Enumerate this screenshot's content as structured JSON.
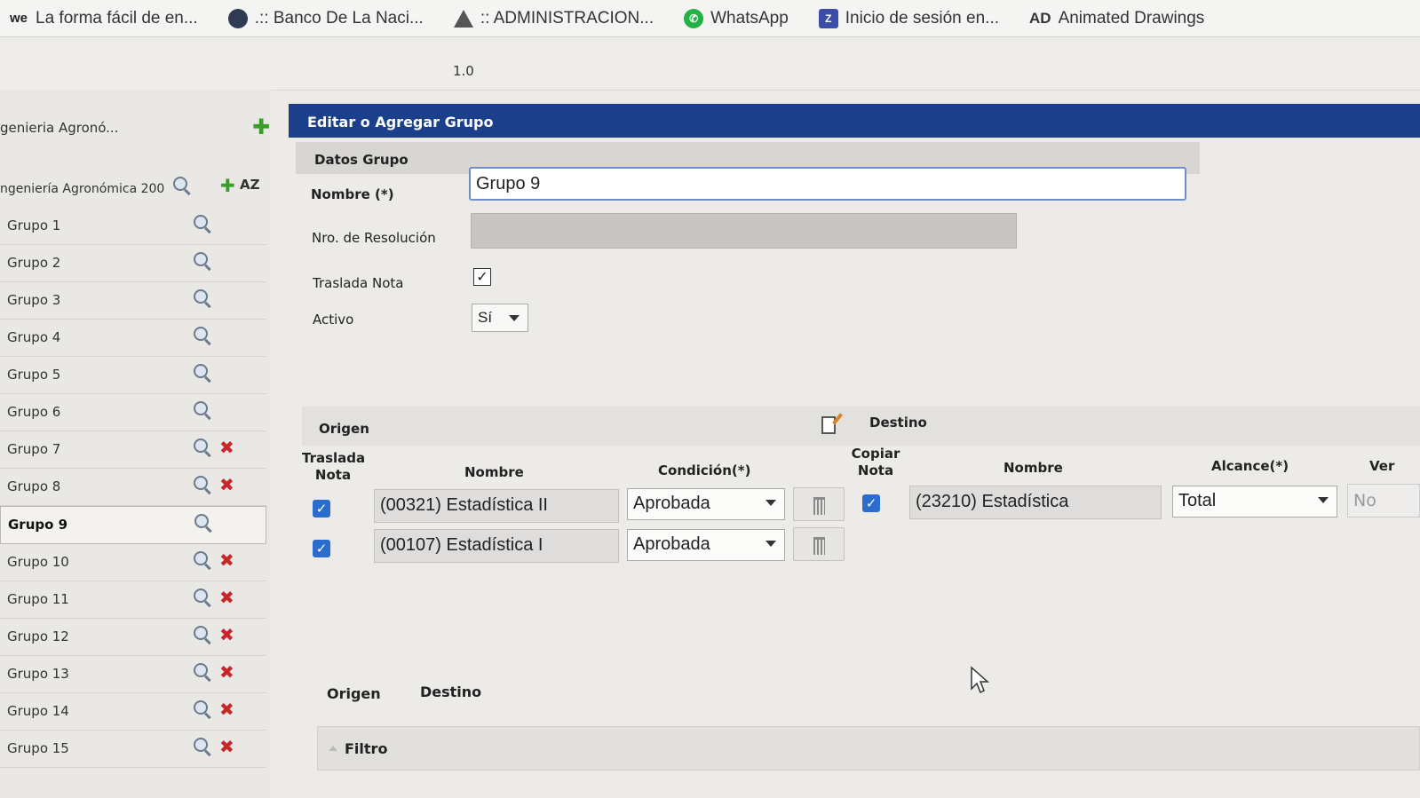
{
  "bookmarks": [
    {
      "icon_text": "we",
      "icon": "we-logo-icon",
      "label": "La forma fácil de en..."
    },
    {
      "icon_text": "",
      "icon": "bank-icon",
      "label": ".:: Banco De La Naci..."
    },
    {
      "icon_text": "",
      "icon": "drive-icon",
      "label": ":: ADMINISTRACION..."
    },
    {
      "icon_text": "",
      "icon": "whatsapp-icon",
      "label": "WhatsApp"
    },
    {
      "icon_text": "",
      "icon": "login-icon",
      "label": "Inicio de sesión en..."
    },
    {
      "icon_text": "AD",
      "icon": "ad-icon",
      "label": "Animated Drawings"
    }
  ],
  "version": "1.0",
  "sidebar": {
    "career_top": "genieria Agronó...",
    "career_sub": "ngeniería Agronómica 200",
    "sort_label": "AZ",
    "groups": [
      {
        "label": "Grupo 1",
        "deletable": false
      },
      {
        "label": "Grupo 2",
        "deletable": false
      },
      {
        "label": "Grupo 3",
        "deletable": false
      },
      {
        "label": "Grupo 4",
        "deletable": false
      },
      {
        "label": "Grupo 5",
        "deletable": false
      },
      {
        "label": "Grupo 6",
        "deletable": false
      },
      {
        "label": "Grupo 7",
        "deletable": true
      },
      {
        "label": "Grupo 8",
        "deletable": true
      },
      {
        "label": "Grupo 9",
        "deletable": false,
        "selected": true
      },
      {
        "label": "Grupo 10",
        "deletable": true
      },
      {
        "label": "Grupo 11",
        "deletable": true
      },
      {
        "label": "Grupo 12",
        "deletable": true
      },
      {
        "label": "Grupo 13",
        "deletable": true
      },
      {
        "label": "Grupo 14",
        "deletable": true
      },
      {
        "label": "Grupo 15",
        "deletable": true
      }
    ]
  },
  "panel": {
    "title": "Editar o Agregar Grupo",
    "section": "Datos Grupo",
    "nombre_label": "Nombre (*)",
    "nombre_value": "Grupo 9",
    "resolucion_label": "Nro. de Resolución",
    "resolucion_value": "",
    "traslada_label": "Traslada Nota",
    "traslada_checked": true,
    "activo_label": "Activo",
    "activo_value": "Sí"
  },
  "origen_destino": {
    "origen_title": "Origen",
    "destino_title": "Destino",
    "origen_headers": {
      "traslada": "Traslada Nota",
      "nombre": "Nombre",
      "condicion": "Condición(*)"
    },
    "destino_headers": {
      "copiar": "Copiar Nota",
      "nombre": "Nombre",
      "alcance": "Alcance(*)",
      "ver": "Ver"
    },
    "origen_rows": [
      {
        "checked": true,
        "nombre": "(00321) Estadística II",
        "condicion": "Aprobada"
      },
      {
        "checked": true,
        "nombre": "(00107) Estadística I",
        "condicion": "Aprobada"
      }
    ],
    "destino_rows": [
      {
        "checked": true,
        "nombre": "(23210) Estadística",
        "alcance": "Total",
        "ver": "No"
      }
    ]
  },
  "bottom": {
    "tab_origen": "Origen",
    "tab_destino": "Destino",
    "filtro": "Filtro"
  },
  "colors": {
    "header_blue": "#1c3f8c",
    "check_blue": "#2b6ccf",
    "delete_red": "#c8262b",
    "add_green": "#3a9d2a"
  }
}
